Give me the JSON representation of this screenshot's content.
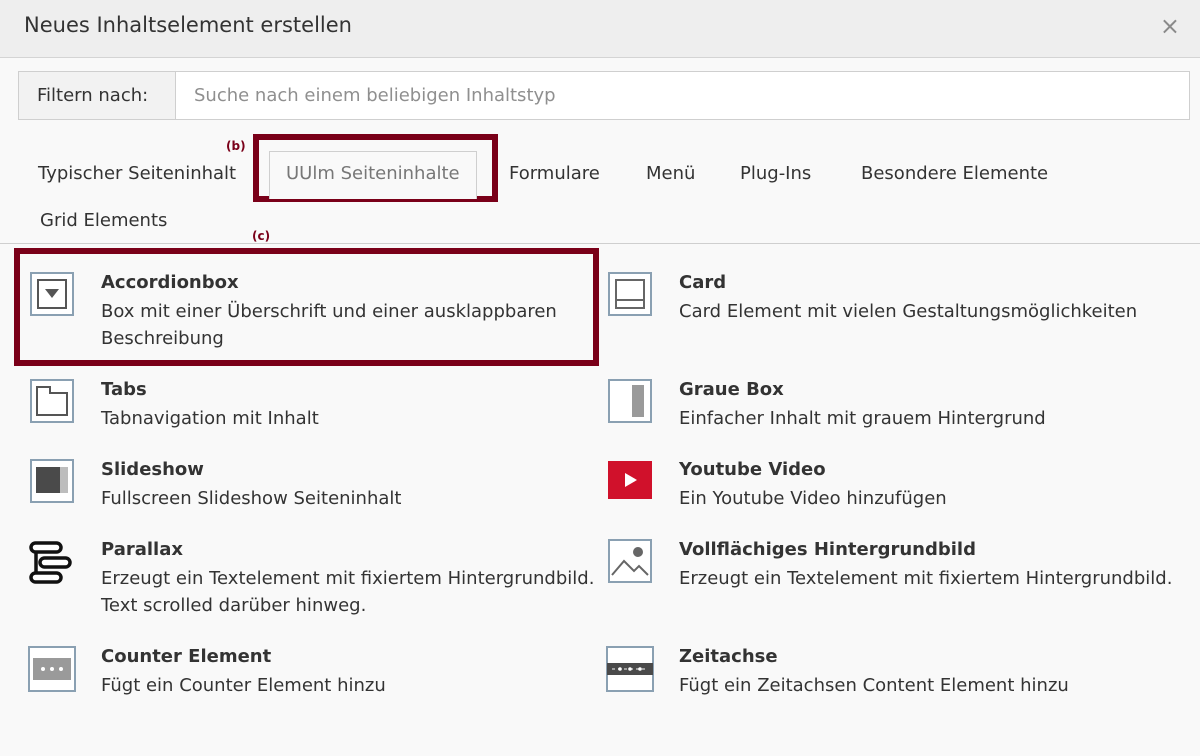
{
  "dialog": {
    "title": "Neues Inhaltselement erstellen",
    "close_label": "×"
  },
  "filter": {
    "label": "Filtern nach:",
    "placeholder": "Suche nach einem beliebigen Inhaltstyp",
    "value": ""
  },
  "annotations": {
    "b": "(b)",
    "c": "(c)",
    "highlight_color": "#7a0019"
  },
  "tabs": [
    {
      "label": "Typischer Seiteninhalt"
    },
    {
      "label": "UUlm Seiteninhalte",
      "active": true
    },
    {
      "label": "Formulare"
    },
    {
      "label": "Menü"
    },
    {
      "label": "Plug-Ins"
    },
    {
      "label": "Besondere Elemente"
    },
    {
      "label": "Grid Elements"
    }
  ],
  "items": [
    {
      "name": "Accordionbox",
      "desc": "Box mit einer Überschrift und einer ausklappbaren Beschreibung",
      "icon": "accordion-icon"
    },
    {
      "name": "Card",
      "desc": "Card Element mit vielen Gestaltungsmöglichkeiten",
      "icon": "card-icon"
    },
    {
      "name": "Tabs",
      "desc": "Tabnavigation mit Inhalt",
      "icon": "tabs-icon"
    },
    {
      "name": "Graue Box",
      "desc": "Einfacher Inhalt mit grauem Hintergrund",
      "icon": "grey-box-icon"
    },
    {
      "name": "Slideshow",
      "desc": "Fullscreen Slideshow Seiteninhalt",
      "icon": "slideshow-icon"
    },
    {
      "name": "Youtube Video",
      "desc": "Ein Youtube Video hinzufügen",
      "icon": "youtube-icon",
      "icon_color": "#d0112b"
    },
    {
      "name": "Parallax",
      "desc": "Erzeugt ein Textelement mit fixiertem Hintergrundbild. Text scrolled darüber hinweg.",
      "icon": "parallax-icon"
    },
    {
      "name": "Vollflächiges Hintergrundbild",
      "desc": "Erzeugt ein Textelement mit fixiertem Hintergrundbild.",
      "icon": "image-icon"
    },
    {
      "name": "Counter Element",
      "desc": "Fügt ein Counter Element hinzu",
      "icon": "counter-icon"
    },
    {
      "name": "Zeitachse",
      "desc": "Fügt ein Zeitachsen Content Element hinzu",
      "icon": "timeline-icon"
    }
  ]
}
